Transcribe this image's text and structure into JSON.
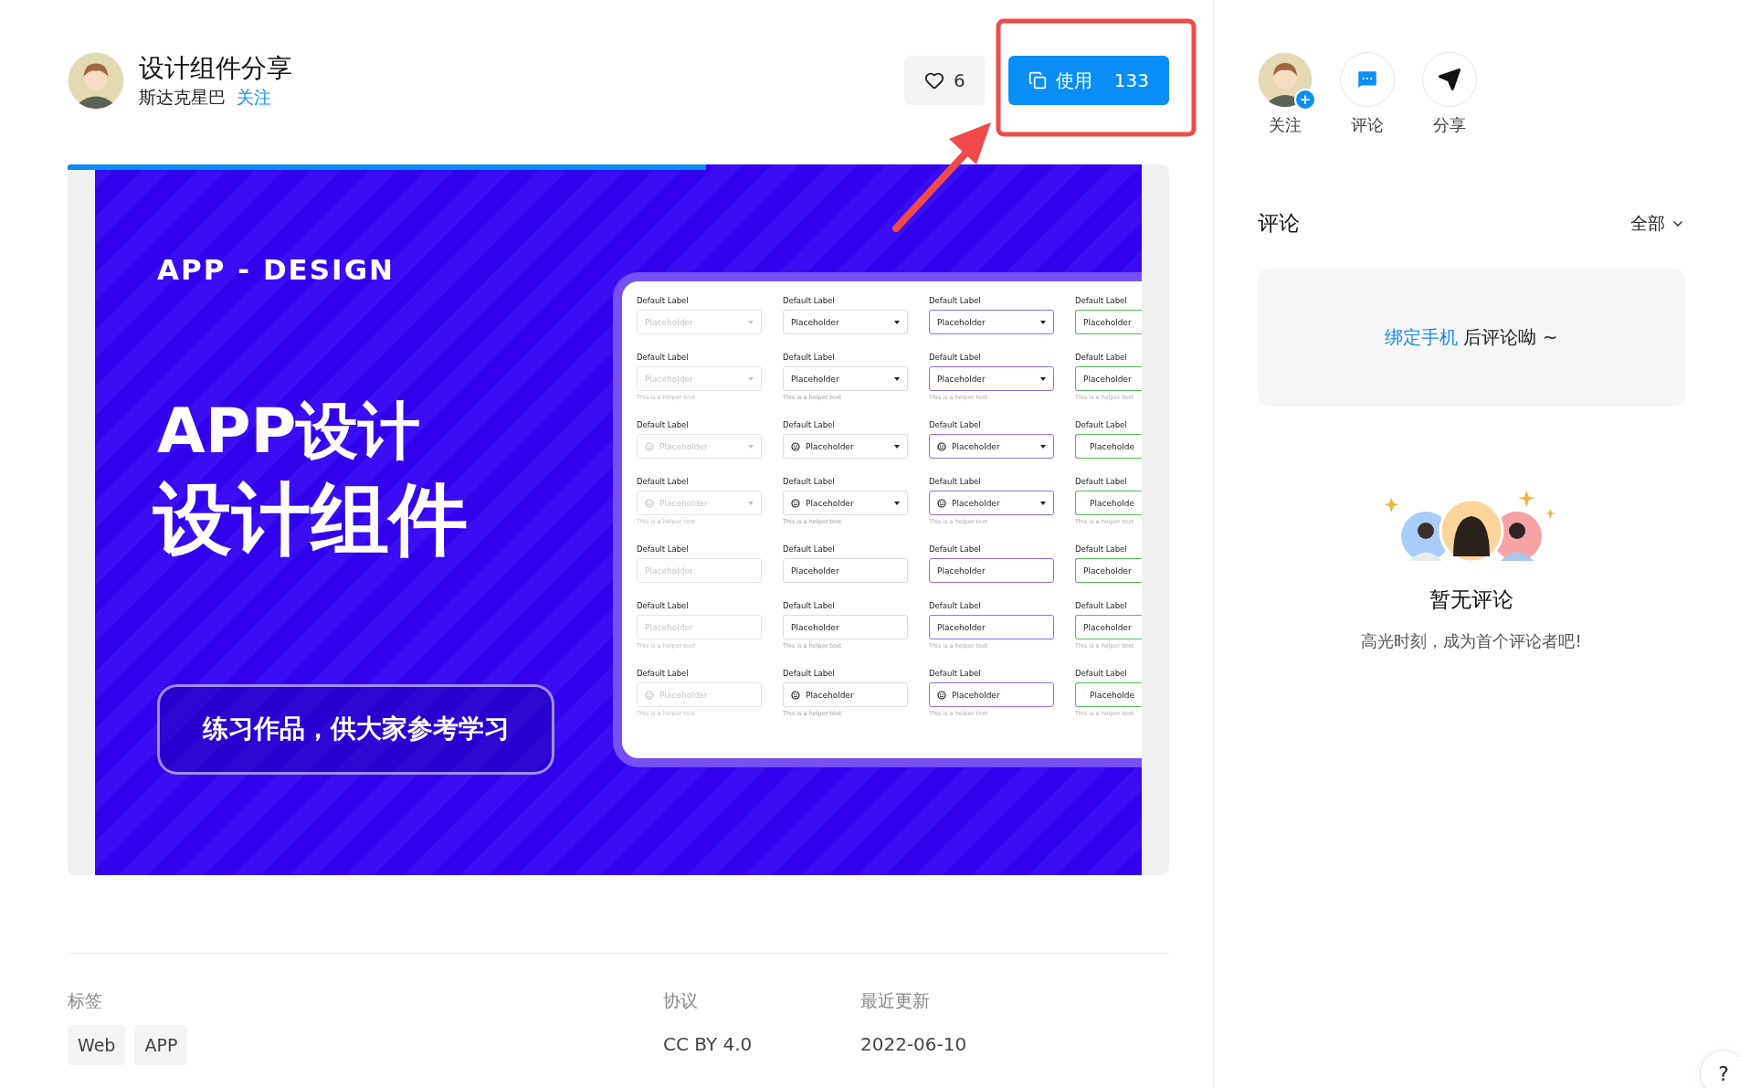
{
  "header": {
    "title": "设计组件分享",
    "author": "斯达克星巴",
    "follow_link": "关注",
    "like": {
      "count": "6",
      "liked": false
    },
    "use_button": {
      "label": "使用",
      "count": "133"
    }
  },
  "preview": {
    "level": 0.58,
    "design": {
      "eyebrow": "APP - DESIGN",
      "title_lines": [
        "APP设计",
        "设计组件"
      ],
      "badge": "练习作品，供大家参考学习",
      "columns": [
        {
          "kind": "disabled"
        },
        {
          "kind": "default"
        },
        {
          "kind": "focused"
        },
        {
          "kind": "success"
        }
      ],
      "rows": [
        {
          "cells": [
            {
              "label": "Default Label",
              "placeholder": "Placeholder",
              "icon": false,
              "dropdown": true
            },
            {
              "label": "Default Label",
              "placeholder": "Placeholder",
              "icon": false,
              "dropdown": true
            },
            {
              "label": "Default Label",
              "placeholder": "Placeholder",
              "icon": false,
              "dropdown": true
            },
            {
              "label": "Default Label",
              "placeholder": "Placeholder",
              "icon": false
            }
          ]
        },
        {
          "cells": [
            {
              "label": "Default Label",
              "placeholder": "Placeholder",
              "helper": "This is a helper text",
              "icon": false,
              "dropdown": true
            },
            {
              "label": "Default Label",
              "placeholder": "Placeholder",
              "helper": "This is a helper text",
              "icon": false,
              "dropdown": true
            },
            {
              "label": "Default Label",
              "placeholder": "Placeholder",
              "helper": "This is a helper text",
              "icon": false,
              "dropdown": true
            },
            {
              "label": "Default Label",
              "placeholder": "Placeholder",
              "helper": "This is a helper text",
              "icon": false
            }
          ]
        },
        {
          "cells": [
            {
              "label": "Default Label",
              "placeholder": "Placeholder",
              "icon": true,
              "dropdown": true
            },
            {
              "label": "Default Label",
              "placeholder": "Placeholder",
              "icon": true,
              "dropdown": true
            },
            {
              "label": "Default Label",
              "placeholder": "Placeholder",
              "icon": true,
              "dropdown": true
            },
            {
              "label": "Default Label",
              "placeholder": "Placeholde",
              "icon": true
            }
          ]
        },
        {
          "cells": [
            {
              "label": "Default Label",
              "placeholder": "Placeholder",
              "helper": "This is a helper text",
              "icon": true,
              "dropdown": true
            },
            {
              "label": "Default Label",
              "placeholder": "Placeholder",
              "helper": "This is a helper text",
              "icon": true,
              "dropdown": true
            },
            {
              "label": "Default Label",
              "placeholder": "Placeholder",
              "helper": "This is a helper text",
              "icon": true,
              "dropdown": true
            },
            {
              "label": "Default Label",
              "placeholder": "Placeholde",
              "helper": "This is a helper text",
              "icon": true
            }
          ]
        },
        {
          "cells": [
            {
              "label": "Default Label",
              "placeholder": "Placeholder",
              "icon": false,
              "dropdown": false
            },
            {
              "label": "Default Label",
              "placeholder": "Placeholder",
              "icon": false,
              "dropdown": false
            },
            {
              "label": "Default Label",
              "placeholder": "Placeholder",
              "icon": false,
              "dropdown": false
            },
            {
              "label": "Default Label",
              "placeholder": "Placeholder",
              "icon": false
            }
          ]
        },
        {
          "cells": [
            {
              "label": "Default Label",
              "placeholder": "Placeholder",
              "helper": "This is a helper text",
              "icon": false,
              "dropdown": false
            },
            {
              "label": "Default Label",
              "placeholder": "Placeholder",
              "helper": "This is a helper text",
              "icon": false,
              "dropdown": false
            },
            {
              "label": "Default Label",
              "placeholder": "Placeholder",
              "helper": "This is a helper text",
              "icon": false,
              "dropdown": false
            },
            {
              "label": "Default Label",
              "placeholder": "Placeholder",
              "helper": "This is a helper text",
              "icon": false
            }
          ]
        },
        {
          "cells": [
            {
              "label": "Default Label",
              "placeholder": "Placeholder",
              "helper": "This is a helper text",
              "icon": true,
              "dropdown": false
            },
            {
              "label": "Default Label",
              "placeholder": "Placeholder",
              "helper": "This is a helper text",
              "icon": true,
              "dropdown": false
            },
            {
              "label": "Default Label",
              "placeholder": "Placeholder",
              "helper": "This is a helper text",
              "icon": true,
              "dropdown": false
            },
            {
              "label": "Default Label",
              "placeholder": "Placeholde",
              "helper": "This is a helper text",
              "icon": true
            }
          ]
        }
      ]
    }
  },
  "meta": {
    "tags_label": "标签",
    "tags": [
      "Web",
      "APP"
    ],
    "license_label": "协议",
    "license": "CC BY 4.0",
    "updated_label": "最近更新",
    "updated": "2022-06-10"
  },
  "actions": [
    {
      "kind": "follow",
      "label": "关注"
    },
    {
      "kind": "comment",
      "label": "评论"
    },
    {
      "kind": "share",
      "label": "分享"
    }
  ],
  "comments": {
    "title": "评论",
    "filter": "全部",
    "bind_prompt": {
      "link": "绑定手机",
      "text": "后评论呦 ~"
    },
    "empty": {
      "title": "暂无评论",
      "subtitle": "高光时刻，成为首个评论者吧!"
    }
  },
  "help": "?"
}
